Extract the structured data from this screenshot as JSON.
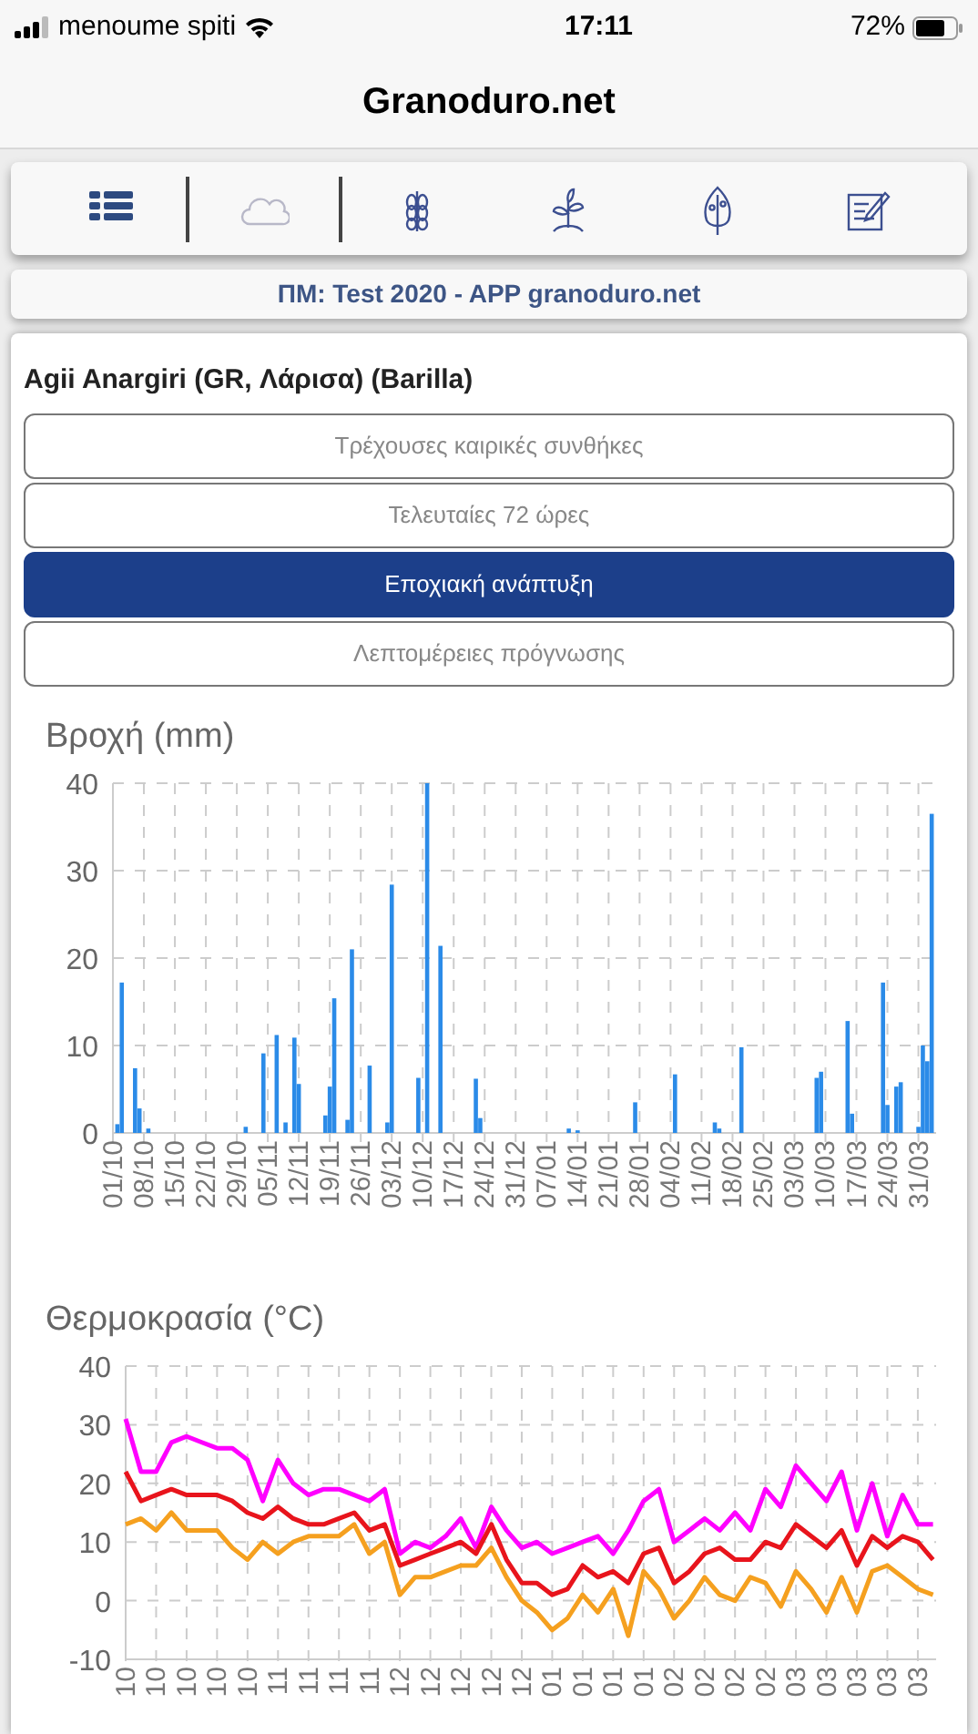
{
  "status_bar": {
    "carrier": "menoume spiti",
    "time": "17:11",
    "battery": "72%"
  },
  "header": {
    "title": "Granoduro.net"
  },
  "toolbar": [
    {
      "selected": false
    },
    {
      "selected": true
    },
    {
      "selected": false
    },
    {
      "selected": false
    },
    {
      "selected": false
    },
    {
      "selected": false
    }
  ],
  "subtitle": "ΠΜ: Test 2020 - APP granoduro.net",
  "location": "Agii Anargiri (GR, Λάρισα) (Barilla)",
  "tabs": [
    {
      "label": "Τρέχουσες καιρικές συνθήκες",
      "selected": false
    },
    {
      "label": "Τελευταίες 72 ώρες",
      "selected": false
    },
    {
      "label": "Εποχιακή ανάπτυξη",
      "selected": true
    },
    {
      "label": "Λεπτομέρειες πρόγνωσης",
      "selected": false
    }
  ],
  "rain_chart": {
    "chart_data": {
      "type": "bar",
      "title": "Βροχή (mm)",
      "grid": true,
      "ylim": [
        0,
        40
      ],
      "yticks": [
        0,
        10,
        20,
        30,
        40
      ],
      "categories": [
        "01/10",
        null,
        null,
        null,
        null,
        null,
        null,
        "08/10",
        null,
        null,
        null,
        null,
        null,
        null,
        "15/10",
        null,
        null,
        null,
        null,
        null,
        null,
        "22/10",
        null,
        null,
        null,
        null,
        null,
        null,
        "29/10",
        null,
        null,
        null,
        null,
        null,
        null,
        "05/11",
        null,
        null,
        null,
        null,
        null,
        null,
        "12/11",
        null,
        null,
        null,
        null,
        null,
        null,
        "19/11",
        null,
        null,
        null,
        null,
        null,
        null,
        "26/11",
        null,
        null,
        null,
        null,
        null,
        null,
        "03/12",
        null,
        null,
        null,
        null,
        null,
        null,
        "10/12",
        null,
        null,
        null,
        null,
        null,
        null,
        "17/12",
        null,
        null,
        null,
        null,
        null,
        null,
        "24/12",
        null,
        null,
        null,
        null,
        null,
        null,
        "31/12",
        null,
        null,
        null,
        null,
        null,
        null,
        "07/01",
        null,
        null,
        null,
        null,
        null,
        null,
        "14/01",
        null,
        null,
        null,
        null,
        null,
        null,
        "21/01",
        null,
        null,
        null,
        null,
        null,
        null,
        "28/01",
        null,
        null,
        null,
        null,
        null,
        null,
        "04/02",
        null,
        null,
        null,
        null,
        null,
        null,
        "11/02",
        null,
        null,
        null,
        null,
        null,
        null,
        "18/02",
        null,
        null,
        null,
        null,
        null,
        null,
        "25/02",
        null,
        null,
        null,
        null,
        null,
        null,
        "03/03",
        null,
        null,
        null,
        null,
        null,
        null,
        "10/03",
        null,
        null,
        null,
        null,
        null,
        null,
        "17/03",
        null,
        null,
        null,
        null,
        null,
        null,
        "24/03",
        null,
        null,
        null,
        null,
        null,
        null,
        "31/03",
        null,
        null,
        null
      ],
      "series": [
        {
          "color": "#2b8be8",
          "values": [
            null,
            1,
            17.2,
            null,
            null,
            7.4,
            2.8,
            null,
            0.5,
            null,
            null,
            null,
            null,
            null,
            null,
            null,
            null,
            null,
            null,
            null,
            null,
            null,
            null,
            null,
            null,
            null,
            null,
            null,
            null,
            null,
            0.7,
            null,
            null,
            null,
            9.1,
            null,
            null,
            11.2,
            null,
            1.2,
            null,
            10.9,
            5.6,
            null,
            null,
            null,
            null,
            null,
            2,
            5.3,
            15.4,
            null,
            null,
            1.5,
            21,
            null,
            null,
            null,
            7.7,
            null,
            null,
            null,
            1.2,
            28.4,
            null,
            null,
            null,
            null,
            null,
            6.3,
            null,
            40,
            null,
            null,
            21.4,
            null,
            null,
            null,
            null,
            null,
            null,
            null,
            6.2,
            1.7,
            null,
            null,
            null,
            null,
            null,
            null,
            null,
            null,
            null,
            null,
            null,
            null,
            null,
            null,
            null,
            null,
            null,
            null,
            null,
            0.5,
            null,
            0.3,
            null,
            null,
            null,
            null,
            null,
            null,
            null,
            null,
            null,
            null,
            null,
            null,
            3.5,
            null,
            null,
            null,
            null,
            null,
            null,
            null,
            null,
            6.7,
            null,
            null,
            null,
            null,
            null,
            null,
            null,
            null,
            1.2,
            0.5,
            null,
            null,
            null,
            null,
            9.8,
            null,
            null,
            null,
            null,
            null,
            null,
            null,
            null,
            null,
            null,
            null,
            null,
            null,
            null,
            null,
            null,
            6.3,
            7,
            null,
            null,
            null,
            null,
            null,
            12.8,
            2.2,
            null,
            null,
            null,
            null,
            null,
            null,
            17.2,
            3.2,
            null,
            5.3,
            5.8,
            null,
            null,
            null,
            0.7,
            10,
            8.2,
            36.5
          ]
        }
      ]
    }
  },
  "temp_chart": {
    "chart_data": {
      "type": "line",
      "title": "Θερμοκρασία (°C)",
      "grid": true,
      "ylim": [
        -10,
        40
      ],
      "yticks": [
        -10,
        0,
        10,
        20,
        30,
        40
      ],
      "categories": [
        "10",
        null,
        "10",
        null,
        "10",
        null,
        "10",
        null,
        "10",
        null,
        "11",
        null,
        "11",
        null,
        "11",
        null,
        "11",
        null,
        "12",
        null,
        "12",
        null,
        "12",
        null,
        "12",
        null,
        "12",
        null,
        "01",
        null,
        "01",
        null,
        "01",
        null,
        "01",
        null,
        "02",
        null,
        "02",
        null,
        "02",
        null,
        "02",
        null,
        "03",
        null,
        "03",
        null,
        "03",
        null,
        "03",
        null,
        "03",
        null
      ],
      "series": [
        {
          "color": "#ff00ff",
          "values": [
            31,
            22,
            22,
            27,
            28,
            27,
            26,
            26,
            24,
            17,
            24,
            20,
            18,
            19,
            19,
            18,
            17,
            19,
            8,
            10,
            9,
            11,
            14,
            9,
            16,
            12,
            9,
            10,
            8,
            9,
            10,
            11,
            8,
            12,
            17,
            19,
            10,
            12,
            14,
            12,
            15,
            12,
            19,
            16,
            23,
            20,
            17,
            22,
            12,
            20,
            11,
            18,
            13,
            13
          ]
        },
        {
          "color": "#e8141c",
          "values": [
            22,
            17,
            18,
            19,
            18,
            18,
            18,
            17,
            15,
            14,
            16,
            14,
            13,
            13,
            14,
            15,
            12,
            13,
            6,
            7,
            8,
            9,
            10,
            8,
            13,
            7,
            3,
            3,
            1,
            2,
            6,
            4,
            5,
            3,
            8,
            9,
            3,
            5,
            8,
            9,
            7,
            7,
            10,
            9,
            13,
            11,
            9,
            12,
            6,
            11,
            9,
            11,
            10,
            7
          ]
        },
        {
          "color": "#f5a01f",
          "values": [
            13,
            14,
            12,
            15,
            12,
            12,
            12,
            9,
            7,
            10,
            8,
            10,
            11,
            11,
            11,
            13,
            8,
            10,
            1,
            4,
            4,
            5,
            6,
            6,
            9,
            4,
            0,
            -2,
            -5,
            -3,
            1,
            -2,
            2,
            -6,
            5,
            2,
            -3,
            0,
            4,
            1,
            0,
            4,
            3,
            -1,
            5,
            2,
            -2,
            4,
            -2,
            5,
            6,
            4,
            2,
            1
          ]
        }
      ]
    }
  }
}
